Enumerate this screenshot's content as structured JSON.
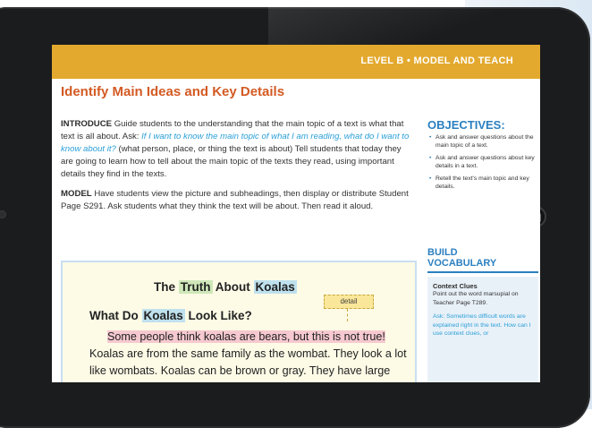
{
  "page": {
    "header": "LEVEL B • MODEL AND TEACH",
    "title": "Identify Main Ideas and Key Details",
    "introduce": {
      "label": "INTRODUCE",
      "text1": " Guide students to the understanding that the main topic of a text is what that text is all about. Ask: ",
      "question": "If I want to know the main topic of what I am reading, what do I want to know about it?",
      "text2": " (what person, place, or thing the text is about) Tell students that today they are going to learn how to tell about the main topic of the texts they read, using important details they find in the texts."
    },
    "model": {
      "label": "MODEL",
      "text": " Have students view the picture and subheadings, then display or distribute Student Page S291. Ask students what they think the text will be about. Then read it aloud."
    },
    "objectives": {
      "heading": "OBJECTIVES:",
      "items": [
        "Ask and answer questions about the main topic of a text.",
        "Ask and answer questions about key details in a text.",
        "Retell the text's main topic and key details."
      ]
    },
    "vocabulary": {
      "heading_line1": "BUILD",
      "heading_line2": "VOCABULARY",
      "subhead": "Context Clues",
      "text": "Point out the word marsupial on Teacher Page T289.",
      "ask": "Ask: Sometimes difficult words are explained right in the text. How can I use context clues, or"
    },
    "reader": {
      "title_the": "The ",
      "title_truth": "Truth",
      "title_about": " About ",
      "title_koalas": "Koalas",
      "sub_what": "What Do ",
      "sub_koalas": "Koalas",
      "sub_rest": " Look Like?",
      "detail_label": "detail",
      "hl_text": "Some people think koalas are bears, but this is not true!",
      "body_rest": " Koalas are from the same family as the wombat. They look a lot like wombats. Koalas can be brown or gray. They have large"
    }
  }
}
